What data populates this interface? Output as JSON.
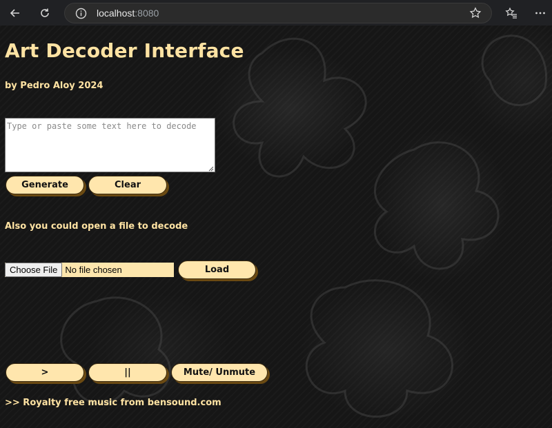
{
  "browser": {
    "url_host": "localhost",
    "url_port": ":8080"
  },
  "app": {
    "title": "Art Decoder Interface",
    "subtitle": "by Pedro Aloy 2024"
  },
  "decoder": {
    "placeholder": "Type or paste some text here to decode",
    "value": "",
    "generate_label": "Generate",
    "clear_label": "Clear"
  },
  "file_section": {
    "prompt": "Also you could open a file to decode",
    "choose_label": "Choose File",
    "status": "No file chosen",
    "load_label": "Load"
  },
  "player": {
    "play_label": ">",
    "pause_label": "||",
    "mute_label": "Mute/ Unmute"
  },
  "footer": {
    "credits": ">> Royalty free music from bensound.com"
  },
  "colors": {
    "accent_text": "#ffe3a3",
    "button_bg": "#ffe6ad",
    "page_bg": "#161616"
  }
}
